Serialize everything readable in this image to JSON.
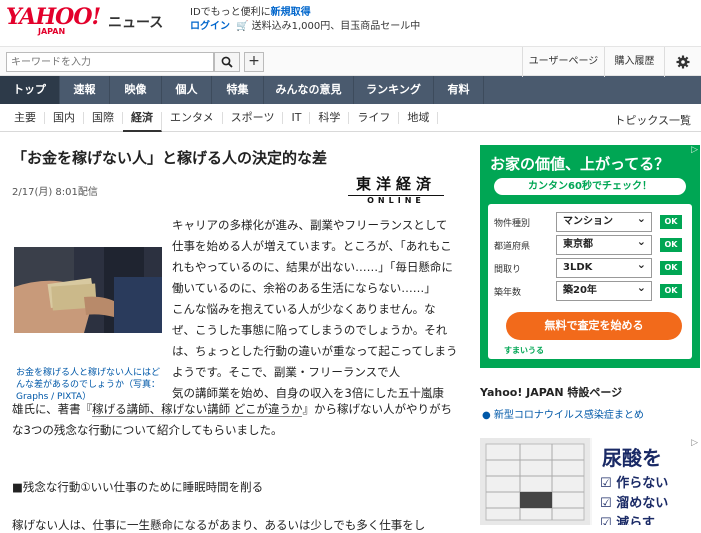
{
  "header": {
    "logo": "YAHOO!",
    "logo_sub": "JAPAN",
    "news_label": "ニュース",
    "promo_line1_prefix": "IDでもっと便利に",
    "promo_line1_link": "新規取得",
    "promo_line2_link": "ログイン",
    "promo_line2_text": "送料込み1,000円、目玉商品セール中"
  },
  "search": {
    "placeholder": "キーワードを入力",
    "user_page": "ユーザーページ",
    "history": "購入履歴"
  },
  "main_nav": [
    "トップ",
    "速報",
    "映像",
    "個人",
    "特集",
    "みんなの意見",
    "ランキング",
    "有料"
  ],
  "sub_nav": [
    "主要",
    "国内",
    "国際",
    "経済",
    "エンタメ",
    "スポーツ",
    "IT",
    "科学",
    "ライフ",
    "地域"
  ],
  "sub_nav_topics": "トピックス一覧",
  "article": {
    "title": "「お金を稼げない人」と稼げる人の決定的な差",
    "date": "2/17(月) 8:01配信",
    "publisher_jp": "東洋経済",
    "publisher_en": "ONLINE",
    "caption": "お金を稼げる人と稼げない人にはどんな差があるのでしょうか（写真：Graphs / PIXTA）",
    "para1": "キャリアの多様化が進み、副業やフリーランスとして仕事を始める人が増えています。ところが、「あれもこれもやっているのに、結果が出ない……」「毎日懸命に働いているのに、余裕のある生活にならない……」",
    "para2": "こんな悩みを抱えている人が少なくありません。なぜ、こうした事態に陥ってしまうのでしょうか。それは、ちょっとした行動の違いが重なって起こってしまうようです。そこで、副業・フリーランスで人",
    "para2b": "気の講師業を始め、自身の収入を3倍にした五十嵐康",
    "para3_pre": "雄氏に、著書『",
    "para3_link": "稼げる講師、稼げない講師 どこが違うか",
    "para3_post": "』から稼げない人がやりがちな3つの残念な行動について紹介してもらいました。",
    "section": "■残念な行動①いい仕事のために睡眠時間を削る",
    "last_line": "稼げない人は、仕事に一生懸命になるがあまり、あるいは少しでも多く仕事をし"
  },
  "ad": {
    "title": "お家の価値、上がってる？",
    "sub": "カンタン60秒でチェック！",
    "rows": [
      {
        "label": "物件種別",
        "value": "マンション",
        "ok": "OK"
      },
      {
        "label": "都道府県",
        "value": "東京都",
        "ok": "OK"
      },
      {
        "label": "間取り",
        "value": "3LDK",
        "ok": "OK"
      },
      {
        "label": "築年数",
        "value": "築20年",
        "ok": "OK"
      }
    ],
    "cta": "無料で査定を始める",
    "brand": "すまいうる"
  },
  "special": {
    "title": "Yahoo! JAPAN 特設ページ",
    "link": "新型コロナウイルス感染症まとめ"
  },
  "ad2": {
    "kanji": "尿酸を",
    "checks": [
      "作らない",
      "溜めない",
      "減らす"
    ]
  },
  "colors": {
    "brand_red": "#e3002b",
    "nav_bg": "#4a5a6e",
    "ad_green": "#00a654",
    "cta_orange": "#f26a1b",
    "link_blue": "#0058a8"
  }
}
